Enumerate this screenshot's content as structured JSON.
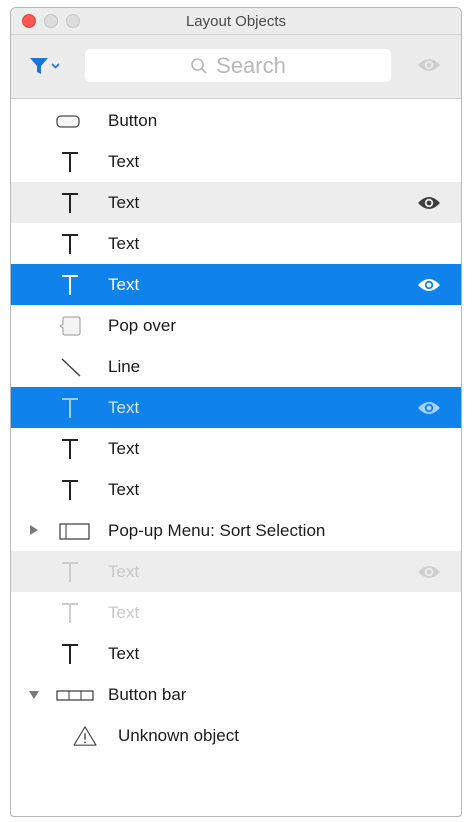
{
  "window": {
    "title": "Layout Objects"
  },
  "toolbar": {
    "filter_icon": "filter-icon",
    "search_placeholder": "Search",
    "visibility_icon": "eye-icon"
  },
  "colors": {
    "selection": "#0f82ec",
    "alternate_row": "#ededed",
    "close_button": "#fc5753"
  },
  "rows": [
    {
      "label": "Button",
      "icon": "button-icon",
      "state": "normal",
      "eye": false
    },
    {
      "label": "Text",
      "icon": "text-icon",
      "state": "normal",
      "eye": false
    },
    {
      "label": "Text",
      "icon": "text-icon",
      "state": "alternate",
      "eye": true
    },
    {
      "label": "Text",
      "icon": "text-icon",
      "state": "normal",
      "eye": false
    },
    {
      "label": "Text",
      "icon": "text-icon",
      "state": "selected",
      "eye": true
    },
    {
      "label": "Pop over",
      "icon": "popover-icon",
      "state": "normal",
      "eye": false
    },
    {
      "label": "Line",
      "icon": "line-icon",
      "state": "normal",
      "eye": false
    },
    {
      "label": "Text",
      "icon": "text-icon",
      "state": "selected-faint",
      "eye": true
    },
    {
      "label": "Text",
      "icon": "text-icon",
      "state": "normal",
      "eye": false
    },
    {
      "label": "Text",
      "icon": "text-icon",
      "state": "normal",
      "eye": false
    },
    {
      "label": "Pop-up Menu: Sort Selection",
      "icon": "popup-menu-icon",
      "state": "collapsed",
      "eye": false
    },
    {
      "label": "Text",
      "icon": "text-icon",
      "state": "dimmed-alternate",
      "eye": true
    },
    {
      "label": "Text",
      "icon": "text-icon",
      "state": "dimmed",
      "eye": false
    },
    {
      "label": "Text",
      "icon": "text-icon",
      "state": "normal",
      "eye": false
    },
    {
      "label": "Button bar",
      "icon": "button-bar-icon",
      "state": "expanded",
      "eye": false
    },
    {
      "label": "Unknown object",
      "icon": "warning-icon",
      "state": "child",
      "eye": false
    }
  ]
}
